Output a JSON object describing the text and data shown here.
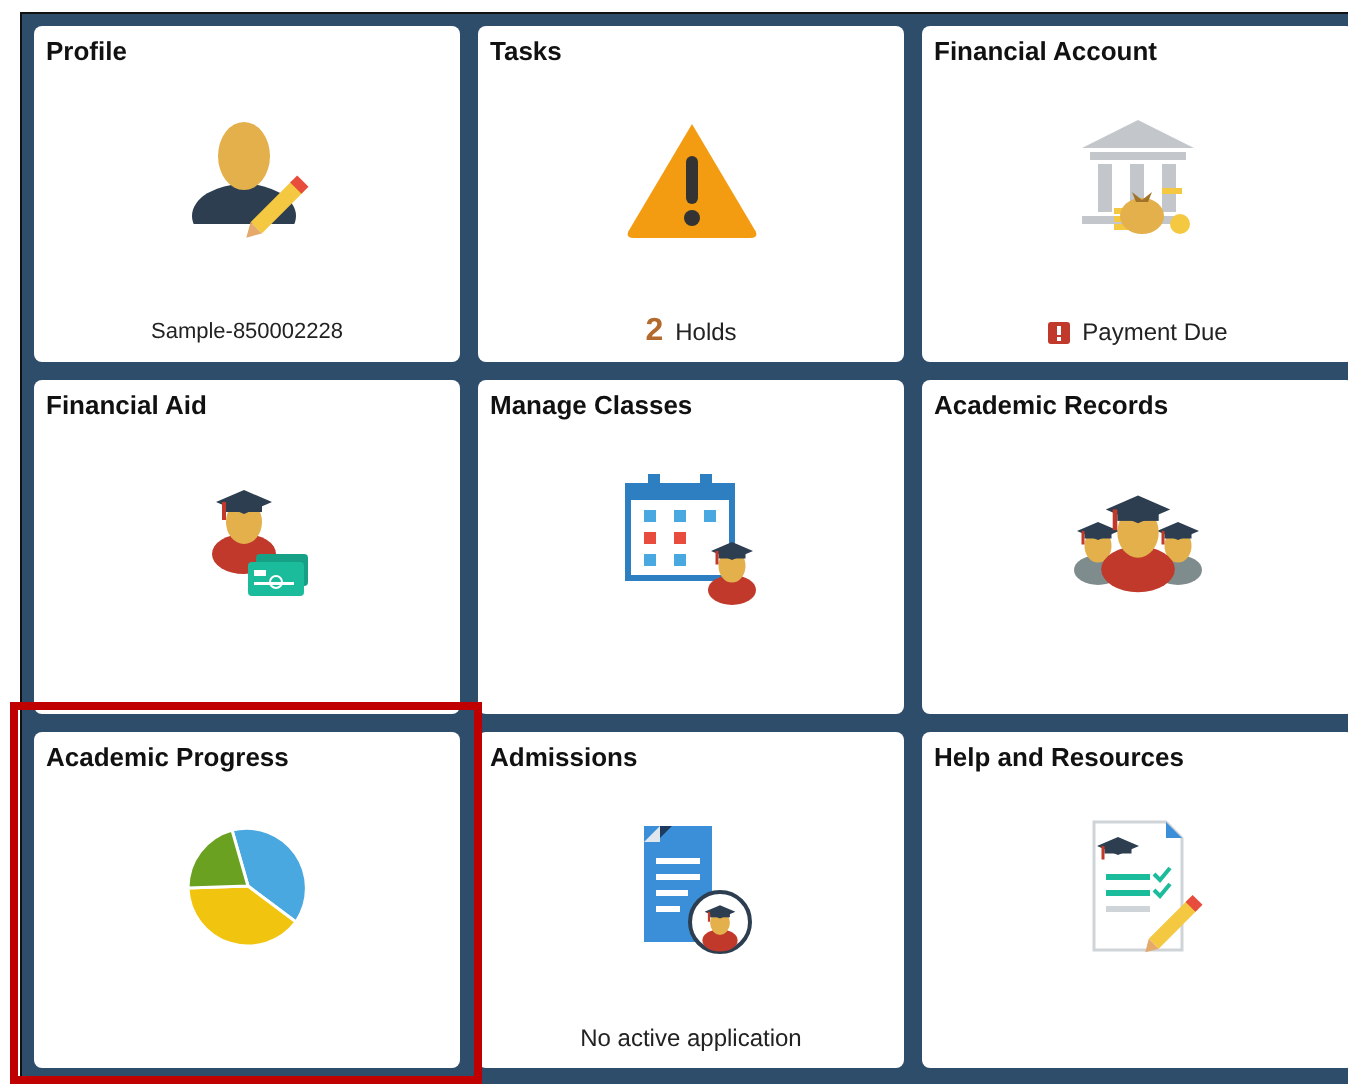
{
  "tiles": [
    {
      "title": "Profile",
      "highlighted": false,
      "footer": {
        "kind": "text",
        "text": "Sample-850002228"
      }
    },
    {
      "title": "Tasks",
      "highlighted": false,
      "footer": {
        "kind": "count",
        "count": "2",
        "text": "Holds"
      }
    },
    {
      "title": "Financial Account",
      "highlighted": false,
      "footer": {
        "kind": "alert",
        "text": "Payment Due"
      }
    },
    {
      "title": "Financial Aid",
      "highlighted": false
    },
    {
      "title": "Manage Classes",
      "highlighted": false
    },
    {
      "title": "Academic Records",
      "highlighted": false
    },
    {
      "title": "Academic Progress",
      "highlighted": true
    },
    {
      "title": "Admissions",
      "highlighted": false,
      "footer": {
        "kind": "status",
        "text": "No active application"
      }
    },
    {
      "title": "Help and Resources",
      "highlighted": false
    }
  ]
}
